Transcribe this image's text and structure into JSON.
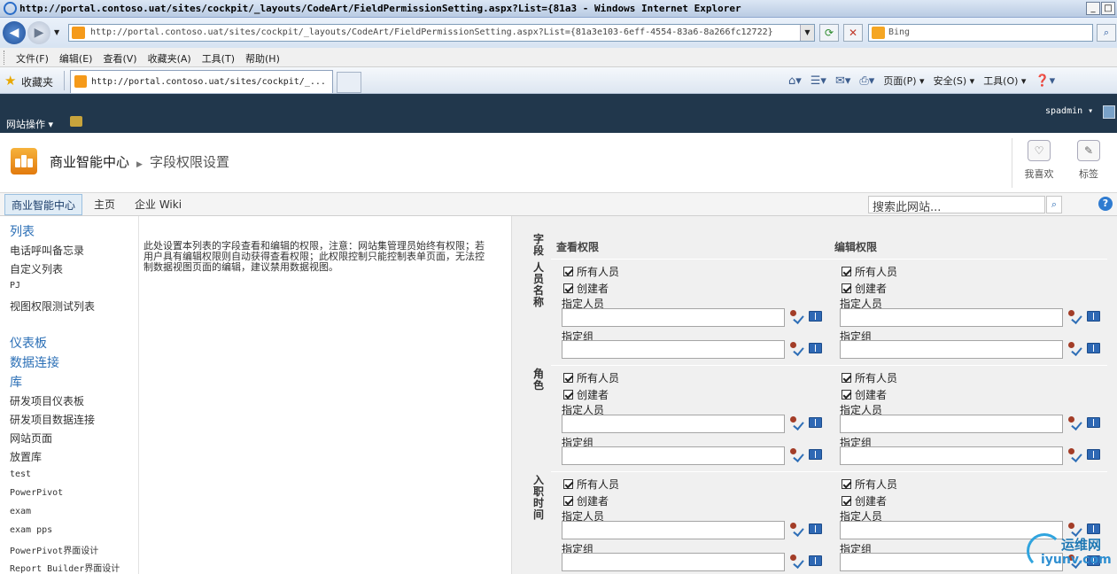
{
  "browser": {
    "title": "http://portal.contoso.uat/sites/cockpit/_layouts/CodeArt/FieldPermissionSetting.aspx?List={81a3 - Windows Internet Explorer",
    "address": "http://portal.contoso.uat/sites/cockpit/_layouts/CodeArt/FieldPermissionSetting.aspx?List={81a3e103-6eff-4554-83a6-8a266fc12722}",
    "search_placeholder": "Bing",
    "menu": [
      "文件(F)",
      "编辑(E)",
      "查看(V)",
      "收藏夹(A)",
      "工具(T)",
      "帮助(H)"
    ],
    "favorites_label": "收藏夹",
    "tab_label": "http://portal.contoso.uat/sites/cockpit/_...",
    "command_bar": [
      "页面(P)",
      "安全(S)",
      "工具(O)"
    ]
  },
  "ribbon": {
    "site_actions": "网站操作",
    "user": "spadmin"
  },
  "header": {
    "site_title": "商业智能中心",
    "page_title": "字段权限设置",
    "i_like_it": "我喜欢",
    "tags": "标签"
  },
  "topnav": {
    "items": [
      "商业智能中心",
      "主页",
      "企业 Wiki"
    ],
    "search_placeholder": "搜索此网站..."
  },
  "quicklaunch": {
    "lists_heading": "列表",
    "lists": [
      "电话呼叫备忘录",
      "自定义列表",
      "PJ",
      "视图权限测试列表"
    ],
    "dashboards": "仪表板",
    "data_connections": "数据连接",
    "libraries_heading": "库",
    "libraries": [
      "研发项目仪表板",
      "研发项目数据连接",
      "网站页面",
      "放置库",
      "test",
      "PowerPivot",
      "exam",
      "exam pps",
      "PowerPivot界面设计",
      "Report Builder界面设计"
    ]
  },
  "description": "此处设置本列表的字段查看和编辑的权限，注意：网站集管理员始终有权限；若用户具有编辑权限则自动获得查看权限；此权限控制只能控制表单页面，无法控制数据视图页面的编辑，建议禁用数据视图。",
  "grid": {
    "field_header": "字段",
    "view_header": "查看权限",
    "edit_header": "编辑权限",
    "rows": [
      {
        "field": "人员名称"
      },
      {
        "field": "角色"
      },
      {
        "field": "入职时间"
      }
    ],
    "labels": {
      "everyone": "所有人员",
      "creator": "创建者",
      "specified_people": "指定人员",
      "specified_group": "指定组"
    }
  },
  "watermark": {
    "line1": "运维网",
    "line2": "iyunv.com"
  }
}
